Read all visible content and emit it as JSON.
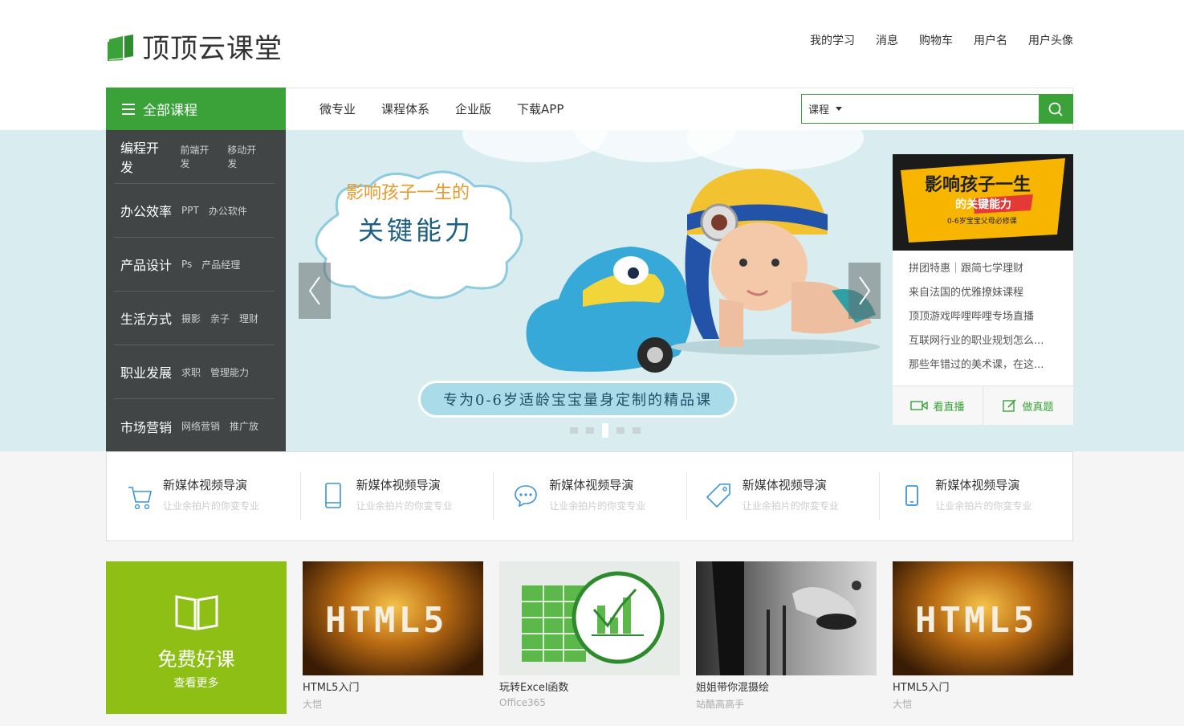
{
  "brand": {
    "name": "顶顶云课堂",
    "color": "#3aa239"
  },
  "user_nav": [
    "我的学习",
    "消息",
    "购物车",
    "用户名",
    "用户头像"
  ],
  "nav": {
    "all_courses": "全部课程",
    "items": [
      "微专业",
      "课程体系",
      "企业版",
      "下载APP"
    ]
  },
  "search": {
    "type": "课程",
    "placeholder": ""
  },
  "side_menu": [
    {
      "main": "编程开发",
      "subs": [
        "前端开发",
        "移动开发"
      ]
    },
    {
      "main": "办公效率",
      "subs": [
        "PPT",
        "办公软件"
      ]
    },
    {
      "main": "产品设计",
      "subs": [
        "Ps",
        "产品经理"
      ]
    },
    {
      "main": "生活方式",
      "subs": [
        "摄影",
        "亲子",
        "理财"
      ]
    },
    {
      "main": "职业发展",
      "subs": [
        "求职",
        "管理能力"
      ]
    },
    {
      "main": "市场营销",
      "subs": [
        "网络营销",
        "推广放"
      ]
    }
  ],
  "banner": {
    "line1": "影响孩子一生的",
    "line2": "关键能力",
    "pill": "专为0-6岁适龄宝宝量身定制的精品课",
    "slide_count": 5,
    "active_slide": 3
  },
  "promo": {
    "image_line1": "影响孩子一生",
    "image_line2": "的关键能力",
    "image_line3": "0-6岁宝宝父母必修课",
    "list": [
      "拼团特惠｜跟简七学理财",
      "来自法国的优雅撩妹课程",
      "顶顶游戏哔哩哔哩专场直播",
      "互联网行业的职业规划怎么...",
      "那些年错过的美术课，在这..."
    ],
    "live_label": "看直播",
    "quiz_label": "做真题"
  },
  "features": [
    {
      "icon": "cart-icon",
      "title": "新媒体视频导演",
      "desc": "让业余拍片的你变专业"
    },
    {
      "icon": "tablet-icon",
      "title": "新媒体视频导演",
      "desc": "让业余拍片的你变专业"
    },
    {
      "icon": "chat-icon",
      "title": "新媒体视频导演",
      "desc": "让业余拍片的你变专业"
    },
    {
      "icon": "tag-icon",
      "title": "新媒体视频导演",
      "desc": "让业余拍片的你变专业"
    },
    {
      "icon": "phone-icon",
      "title": "新媒体视频导演",
      "desc": "让业余拍片的你变专业"
    }
  ],
  "free_course": {
    "title": "免费好课",
    "more": "查看更多",
    "color": "#8dbf15"
  },
  "courses": [
    {
      "title": "HTML5入门",
      "sub": "大恺",
      "image_text": "HTML5"
    },
    {
      "title": "玩转Excel函数",
      "sub": "Office365",
      "image_text": ""
    },
    {
      "title": "姐姐带你混摄绘",
      "sub": "站酷高高手",
      "image_text": ""
    },
    {
      "title": "HTML5入门",
      "sub": "大恺",
      "image_text": "HTML5"
    }
  ]
}
